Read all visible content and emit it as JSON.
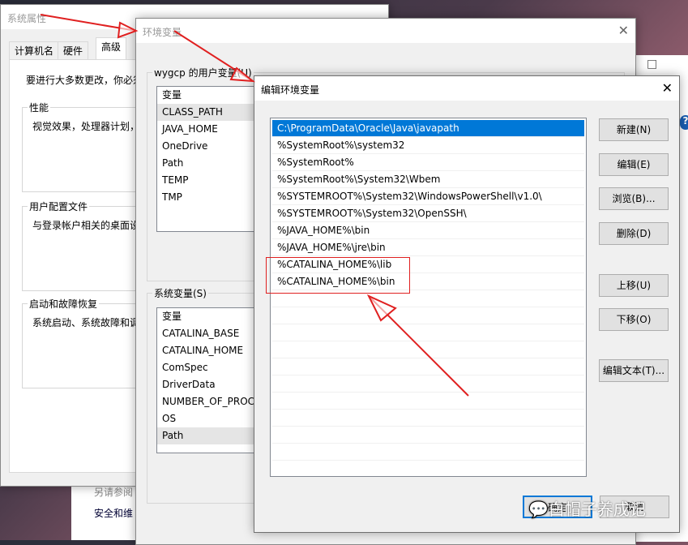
{
  "bg_window": {
    "see_also": "另请参阅",
    "security": "安全和维",
    "maximize": "□",
    "help": "?"
  },
  "sysprops": {
    "title": "系统属性",
    "tabs": [
      "计算机名",
      "硬件",
      "高级"
    ],
    "intro": "要进行大多数更改，你必须",
    "groups": [
      {
        "label": "性能",
        "text": "视觉效果，处理器计划，"
      },
      {
        "label": "用户配置文件",
        "text": "与登录帐户相关的桌面设"
      },
      {
        "label": "启动和故障恢复",
        "text": "系统启动、系统故障和调"
      }
    ]
  },
  "envvars": {
    "title": "环境变量",
    "user_group": "wygcp 的用户变量(U)",
    "user_header": "变量",
    "user_vars": [
      "CLASS_PATH",
      "JAVA_HOME",
      "OneDrive",
      "Path",
      "TEMP",
      "TMP"
    ],
    "sys_group": "系统变量(S)",
    "sys_header": "变量",
    "sys_vars": [
      "CATALINA_BASE",
      "CATALINA_HOME",
      "ComSpec",
      "DriverData",
      "NUMBER_OF_PROC",
      "OS",
      "Path"
    ]
  },
  "edit": {
    "title": "编辑环境变量",
    "entries": [
      "C:\\ProgramData\\Oracle\\Java\\javapath",
      "%SystemRoot%\\system32",
      "%SystemRoot%",
      "%SystemRoot%\\System32\\Wbem",
      "%SYSTEMROOT%\\System32\\WindowsPowerShell\\v1.0\\",
      "%SYSTEMROOT%\\System32\\OpenSSH\\",
      "%JAVA_HOME%\\bin",
      "%JAVA_HOME%\\jre\\bin",
      "%CATALINA_HOME%\\lib",
      "%CATALINA_HOME%\\bin"
    ],
    "selected": 0,
    "buttons": {
      "new": "新建(N)",
      "edit": "编辑(E)",
      "browse": "浏览(B)...",
      "delete": "删除(D)",
      "up": "上移(U)",
      "down": "下移(O)",
      "edit_text": "编辑文本(T)...",
      "ok": "确定",
      "cancel": "取消"
    }
  },
  "watermark": "白帽子养成记",
  "colors": {
    "accent": "#0078d7",
    "annotation": "#e02020"
  }
}
